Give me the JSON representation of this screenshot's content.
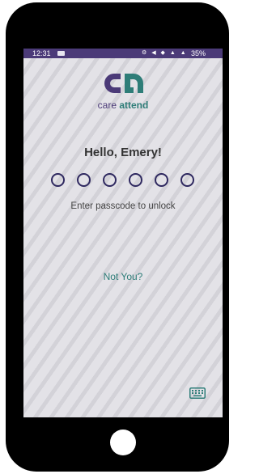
{
  "status_bar": {
    "time": "12:31",
    "battery": "35%"
  },
  "logo": {
    "word_care": "care",
    "word_attend": "attend"
  },
  "lock": {
    "greeting": "Hello, Emery!",
    "passcode_length": 6,
    "passcode_filled": 0,
    "hint": "Enter passcode to unlock",
    "not_you_label": "Not You?"
  },
  "icons": [
    "notification-icon",
    "status-icons",
    "logo-mark-icon",
    "keyboard-icon"
  ],
  "colors": {
    "brand_purple": "#4b3a78",
    "brand_teal": "#2e7d78",
    "dot_outline": "#2f2960",
    "status_bar": "#4b3a78"
  }
}
